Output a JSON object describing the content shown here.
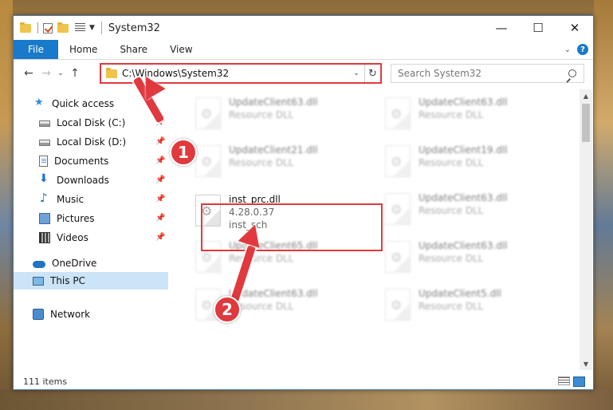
{
  "window": {
    "title": "System32",
    "controls": {
      "minimize": "—",
      "maximize": "☐",
      "close": "✕"
    }
  },
  "ribbon": {
    "file_tab": "File",
    "tabs": [
      "Home",
      "Share",
      "View"
    ],
    "help": "?"
  },
  "address": {
    "path": "C:\\Windows\\System32",
    "search_placeholder": "Search System32"
  },
  "nav": {
    "items": [
      {
        "label": "Quick access",
        "icon": "star-icon",
        "pinned": false
      },
      {
        "label": "Local Disk (C:)",
        "icon": "drive-icon",
        "pinned": true
      },
      {
        "label": "Local Disk (D:)",
        "icon": "drive-icon",
        "pinned": true
      },
      {
        "label": "Documents",
        "icon": "documents-icon",
        "pinned": true
      },
      {
        "label": "Downloads",
        "icon": "downloads-icon",
        "pinned": true
      },
      {
        "label": "Music",
        "icon": "music-icon",
        "pinned": true
      },
      {
        "label": "Pictures",
        "icon": "pictures-icon",
        "pinned": true
      },
      {
        "label": "Videos",
        "icon": "videos-icon",
        "pinned": true
      },
      {
        "label": "OneDrive",
        "icon": "onedrive-icon",
        "pinned": false
      },
      {
        "label": "This PC",
        "icon": "this-pc-icon",
        "pinned": false,
        "selected": true
      },
      {
        "label": "Network",
        "icon": "network-icon",
        "pinned": false
      }
    ]
  },
  "files": [
    {
      "name": "UpdateClient63.dll",
      "type": "Resource DLL",
      "blurred": true
    },
    {
      "name": "UpdateClient63.dll",
      "type": "Resource DLL",
      "blurred": true
    },
    {
      "name": "UpdateClient21.dll",
      "type": "Resource DLL",
      "blurred": true
    },
    {
      "name": "UpdateClient19.dll",
      "type": "Resource DLL",
      "blurred": true
    },
    {
      "name": "inst_prc.dll",
      "version": "4.28.0.37",
      "type": "inst_sch",
      "blurred": false,
      "highlighted": true
    },
    {
      "name": "UpdateClient63.dll",
      "type": "Resource DLL",
      "blurred": true
    },
    {
      "name": "UpdateClient65.dll",
      "type": "Resource DLL",
      "blurred": true
    },
    {
      "name": "UpdateClient63.dll",
      "type": "Resource DLL",
      "blurred": true
    },
    {
      "name": "UpdateClient63.dll",
      "type": "Resource DLL",
      "blurred": true
    },
    {
      "name": "UpdateClient5.dll",
      "type": "Resource DLL",
      "blurred": true
    }
  ],
  "status": {
    "item_count": "111 items"
  },
  "annotations": {
    "step1": "1",
    "step2": "2",
    "color": "#e0393e"
  },
  "colors": {
    "accent": "#1979ca",
    "highlight": "#e0393e",
    "selected_bg": "#cce4f7"
  }
}
